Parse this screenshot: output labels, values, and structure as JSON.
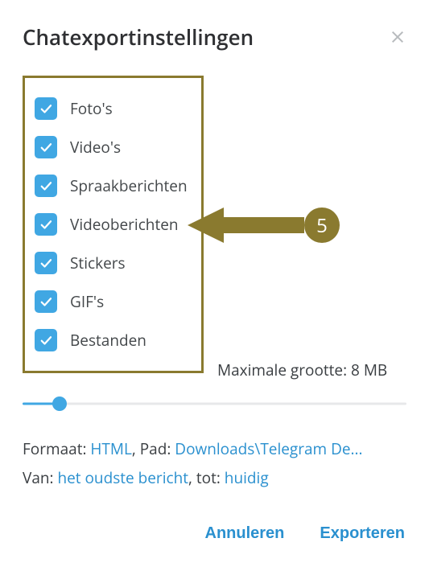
{
  "header": {
    "title": "Chatexportinstellingen"
  },
  "options": [
    {
      "label": "Foto's"
    },
    {
      "label": "Video's"
    },
    {
      "label": "Spraakberichten"
    },
    {
      "label": "Videoberichten"
    },
    {
      "label": "Stickers"
    },
    {
      "label": "GIF's"
    },
    {
      "label": "Bestanden"
    }
  ],
  "maxsize": {
    "label": "Maximale grootte: 8 MB"
  },
  "meta": {
    "format_label": "Formaat: ",
    "format_value": "HTML",
    "path_label": ", Pad: ",
    "path_value": "Downloads\\Telegram De...",
    "from_label": "Van: ",
    "from_value": "het oudste bericht",
    "to_label": ", tot: ",
    "to_value": "huidig"
  },
  "buttons": {
    "cancel": "Annuleren",
    "export": "Exporteren"
  },
  "annotation": {
    "badge": "5"
  }
}
